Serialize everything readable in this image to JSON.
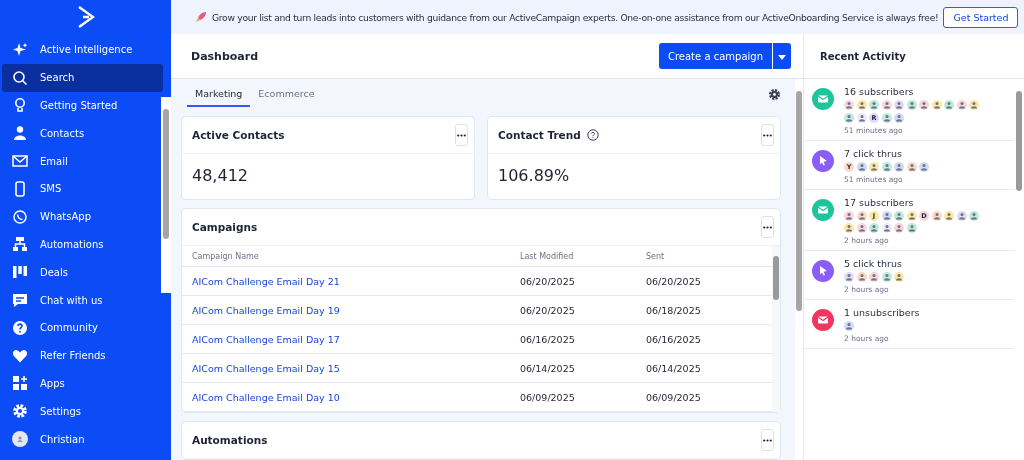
{
  "sidebar": {
    "items": [
      {
        "label": "Active Intelligence",
        "selected": false
      },
      {
        "label": "Search",
        "selected": true
      },
      {
        "label": "Getting Started",
        "selected": false
      },
      {
        "label": "Contacts",
        "selected": false
      },
      {
        "label": "Email",
        "selected": false
      },
      {
        "label": "SMS",
        "selected": false
      },
      {
        "label": "WhatsApp",
        "selected": false
      },
      {
        "label": "Automations",
        "selected": false
      },
      {
        "label": "Deals",
        "selected": false
      },
      {
        "label": "Chat with us",
        "selected": false
      },
      {
        "label": "Community",
        "selected": false
      },
      {
        "label": "Refer Friends",
        "selected": false
      },
      {
        "label": "Apps",
        "selected": false
      },
      {
        "label": "Settings",
        "selected": false
      },
      {
        "label": "Christian",
        "selected": false
      }
    ]
  },
  "banner": {
    "text": "Grow your list and turn leads into customers with guidance from our ActiveCampaign experts. One-on-one assistance from our ActiveOnboarding Service is always free!",
    "button": "Get Started"
  },
  "header": {
    "title": "Dashboard",
    "button": "Create a campaign"
  },
  "tabs": [
    {
      "label": "Marketing",
      "selected": true
    },
    {
      "label": "Ecommerce",
      "selected": false
    }
  ],
  "kpis": [
    {
      "title": "Active Contacts",
      "value": "48,412",
      "help": false
    },
    {
      "title": "Contact Trend",
      "value": "106.89%",
      "help": true
    }
  ],
  "campaigns": {
    "title": "Campaigns",
    "columns": [
      "Campaign Name",
      "Last Modified",
      "Sent"
    ],
    "rows": [
      [
        "AICom Challenge Email Day 21",
        "06/20/2025",
        "06/20/2025"
      ],
      [
        "AICom Challenge Email Day 19",
        "06/20/2025",
        "06/18/2025"
      ],
      [
        "AICom Challenge Email Day 17",
        "06/16/2025",
        "06/16/2025"
      ],
      [
        "AICom Challenge Email Day 15",
        "06/14/2025",
        "06/14/2025"
      ],
      [
        "AICom Challenge Email Day 10",
        "06/09/2025",
        "06/09/2025"
      ]
    ]
  },
  "automations": {
    "title": "Automations"
  },
  "activity": {
    "title": "Recent Activity",
    "items": [
      {
        "kind": "email",
        "text": "16 subscribers",
        "time": "51 minutes ago",
        "avatars": [
          {
            "color": "#f9d5dc"
          },
          {
            "color": "#fbe7a6"
          },
          {
            "color": "#bdeadc"
          },
          {
            "color": "#f9d5dc"
          },
          {
            "color": "#e2d9f8"
          },
          {
            "color": "#bdeadc"
          },
          {
            "color": "#f9d5dc"
          },
          {
            "color": "#fbe7a6"
          },
          {
            "color": "#bdeadc"
          },
          {
            "color": "#f9d5dc"
          },
          {
            "color": "#fbe7a6"
          },
          {
            "color": "#bdeadc"
          },
          {
            "color": "#e8ecf8"
          },
          {
            "color": "#e2d9f8",
            "letter": "R"
          },
          {
            "color": "#bdeadc"
          },
          {
            "color": "#cfdaf7"
          }
        ]
      },
      {
        "kind": "click",
        "text": "7 click thrus",
        "time": "51 minutes ago",
        "avatars": [
          {
            "color": "#fbd9c4",
            "letter": "Y"
          },
          {
            "color": "#cfdaf7"
          },
          {
            "color": "#fbe7a6"
          },
          {
            "color": "#bdeadc"
          },
          {
            "color": "#cfdaf7"
          },
          {
            "color": "#fbd9c4"
          },
          {
            "color": "#cfdaf7"
          }
        ]
      },
      {
        "kind": "email",
        "text": "17 subscribers",
        "time": "2 hours ago",
        "avatars": [
          {
            "color": "#f9d5dc"
          },
          {
            "color": "#fbd9c4"
          },
          {
            "color": "#fbe7a6",
            "letter": "J"
          },
          {
            "color": "#cfdaf7"
          },
          {
            "color": "#bdeadc"
          },
          {
            "color": "#fbe7a6"
          },
          {
            "color": "#f9d5dc",
            "letter": "D"
          },
          {
            "color": "#fbd9c4"
          },
          {
            "color": "#fbe7a6"
          },
          {
            "color": "#e2d9f8"
          },
          {
            "color": "#bdeadc"
          },
          {
            "color": "#fbe7a6"
          },
          {
            "color": "#f9d5dc"
          },
          {
            "color": "#bdeadc"
          },
          {
            "color": "#e8ecf8"
          },
          {
            "color": "#f9d5dc"
          },
          {
            "color": "#bdeadc"
          }
        ]
      },
      {
        "kind": "click",
        "text": "5 click thrus",
        "time": "2 hours ago",
        "avatars": [
          {
            "color": "#e2d9f8"
          },
          {
            "color": "#fbd9c4"
          },
          {
            "color": "#f9d5dc"
          },
          {
            "color": "#bdeadc"
          },
          {
            "color": "#fbe7a6"
          }
        ]
      },
      {
        "kind": "unsubscribe",
        "text": "1 unsubscribers",
        "time": "2 hours ago",
        "avatars": [
          {
            "color": "#cfdaf7"
          }
        ]
      }
    ]
  }
}
